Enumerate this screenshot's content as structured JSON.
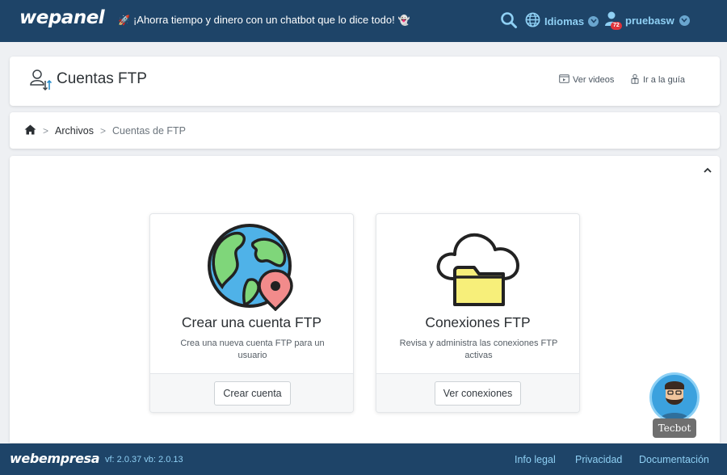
{
  "topbar": {
    "logo": "wepanel",
    "promo_text": "¡Ahorra tiempo y dinero con un chatbot que lo dice todo!",
    "language_label": "Idiomas",
    "username": "pruebasw",
    "notification_count": "72",
    "icons": [
      "rocket-icon",
      "ghost-icon",
      "search-icon",
      "globe-icon",
      "user-icon",
      "chevron-down-icon"
    ]
  },
  "title_card": {
    "title": "Cuentas FTP",
    "videos_link": "Ver videos",
    "guide_link": "Ir a la guía"
  },
  "breadcrumb": {
    "section": "Archivos",
    "current": "Cuentas de FTP"
  },
  "options": [
    {
      "title": "Crear una cuenta FTP",
      "description": "Crea una nueva cuenta FTP para un usuario",
      "button": "Crear cuenta"
    },
    {
      "title": "Conexiones FTP",
      "description": "Revisa y administra las conexiones FTP activas",
      "button": "Ver conexiones"
    }
  ],
  "footer": {
    "logo": "webempresa",
    "version": "vf: 2.0.37 vb: 2.0.13",
    "links": [
      "Info legal",
      "Privacidad",
      "Documentación"
    ]
  },
  "tecbot": {
    "label": "Tecbot"
  },
  "colors": {
    "header": "#1e4468",
    "accent": "#8fd0f4",
    "globe_water": "#4fb2e8",
    "globe_land": "#7fd67a",
    "pin": "#f28b8b",
    "folder": "#f7ef7a"
  }
}
